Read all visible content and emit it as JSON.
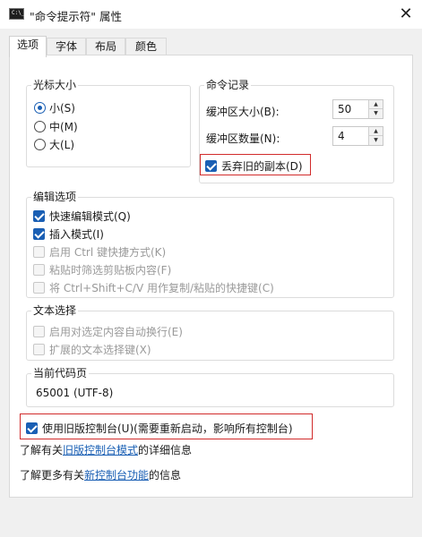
{
  "window": {
    "title": "\"命令提示符\" 属性",
    "icon_label": "C:\\_",
    "close_glyph": "✕"
  },
  "tabs": [
    {
      "label": "选项",
      "active": true
    },
    {
      "label": "字体",
      "active": false
    },
    {
      "label": "布局",
      "active": false
    },
    {
      "label": "颜色",
      "active": false
    }
  ],
  "cursor_size": {
    "legend": "光标大小",
    "options": [
      {
        "label": "小(S)",
        "selected": true
      },
      {
        "label": "中(M)",
        "selected": false
      },
      {
        "label": "大(L)",
        "selected": false
      }
    ]
  },
  "command_history": {
    "legend": "命令记录",
    "buffer_size_label": "缓冲区大小(B):",
    "buffer_size_value": "50",
    "buffer_count_label": "缓冲区数量(N):",
    "buffer_count_value": "4",
    "discard_old_label": "丢弃旧的副本(D)",
    "discard_old_checked": true
  },
  "edit_options": {
    "legend": "编辑选项",
    "items": [
      {
        "label": "快速编辑模式(Q)",
        "checked": true,
        "enabled": true
      },
      {
        "label": "插入模式(I)",
        "checked": true,
        "enabled": true
      },
      {
        "label": "启用 Ctrl 键快捷方式(K)",
        "checked": false,
        "enabled": false
      },
      {
        "label": "粘贴时筛选剪贴板内容(F)",
        "checked": false,
        "enabled": false
      },
      {
        "label": "将 Ctrl+Shift+C/V 用作复制/粘贴的快捷键(C)",
        "checked": false,
        "enabled": false
      }
    ]
  },
  "text_selection": {
    "legend": "文本选择",
    "items": [
      {
        "label": "启用对选定内容自动换行(E)",
        "checked": false,
        "enabled": false
      },
      {
        "label": "扩展的文本选择键(X)",
        "checked": false,
        "enabled": false
      }
    ]
  },
  "codepage": {
    "legend": "当前代码页",
    "value": "65001 (UTF-8)"
  },
  "legacy_console": {
    "label": "使用旧版控制台(U)(需要重新启动，影响所有控制台)",
    "checked": true
  },
  "info_links": {
    "line1_prefix": "了解有关",
    "line1_link": "旧版控制台模式",
    "line1_suffix": "的详细信息",
    "line2_prefix": "了解更多有关",
    "line2_link": "新控制台功能",
    "line2_suffix": "的信息"
  },
  "colors": {
    "accent": "#1a5fb4",
    "highlight_box": "#d12b2b"
  }
}
